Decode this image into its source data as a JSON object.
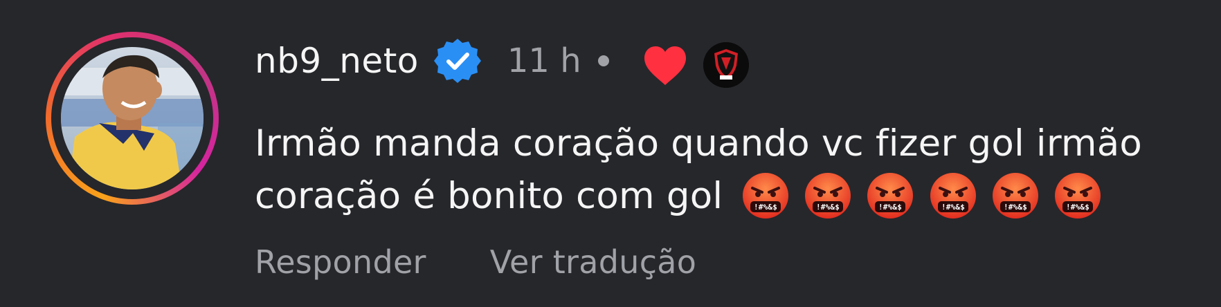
{
  "comment": {
    "username": "nb9_neto",
    "verified_icon": "verified-badge-icon",
    "time": "11 h",
    "text_line1": "Irmão manda coração quando vc fizer gol irmão",
    "text_line2": "coração é bonito com gol",
    "emojis": [
      "face-with-symbols-on-mouth",
      "face-with-symbols-on-mouth",
      "face-with-symbols-on-mouth",
      "face-with-symbols-on-mouth",
      "face-with-symbols-on-mouth",
      "face-with-symbols-on-mouth"
    ],
    "liked_by_creator": true,
    "actions": {
      "reply": "Responder",
      "translate": "Ver tradução"
    }
  },
  "colors": {
    "background": "#26272b",
    "text": "#f5f5f5",
    "muted": "#a0a2a8",
    "verified": "#2a8ff5",
    "heart": "#ff3040"
  }
}
